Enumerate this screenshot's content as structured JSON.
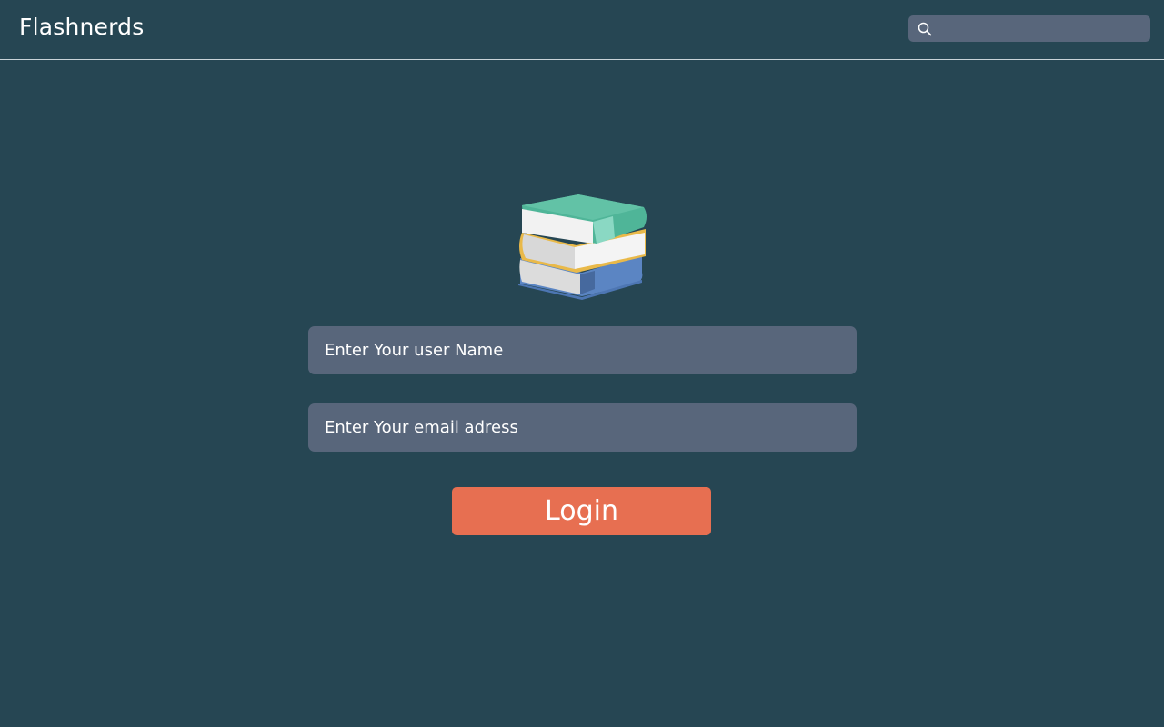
{
  "header": {
    "brand": "Flashnerds",
    "search": {
      "placeholder": "",
      "icon": "search-icon"
    }
  },
  "logo": {
    "icon": "books-icon"
  },
  "form": {
    "username_placeholder": "Enter Your user Name",
    "email_placeholder": "Enter Your email adress",
    "login_label": "Login"
  },
  "colors": {
    "background": "#264653",
    "field": "#58667b",
    "accent": "#e76f51"
  }
}
